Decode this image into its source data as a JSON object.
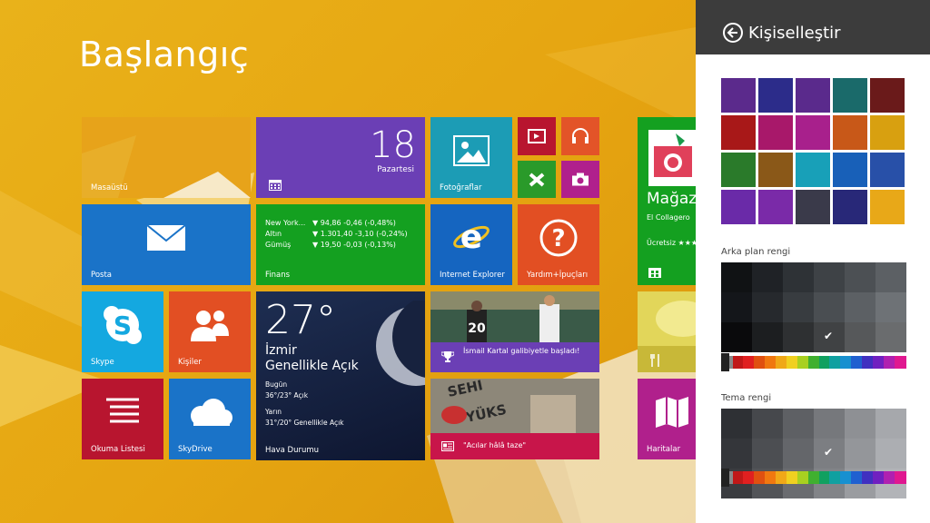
{
  "start": {
    "title": "Başlangıç",
    "tiles": {
      "desktop": "Masaüstü",
      "calendar_number": "18",
      "calendar_day": "Pazartesi",
      "photos": "Fotoğraflar",
      "mail": "Posta",
      "finance": "Finans",
      "finance_rows": [
        {
          "name": "New York...",
          "value": "▼ 94,86 -0,46 (-0,48%)"
        },
        {
          "name": "Altın",
          "value": "▼ 1.301,40 -3,10 (-0,24%)"
        },
        {
          "name": "Gümüş",
          "value": "▼ 19,50 -0,03 (-0,13%)"
        }
      ],
      "ie": "Internet Explorer",
      "help": "Yardım+İpuçları",
      "skype": "Skype",
      "people": "Kişiler",
      "weather_temp": "27°",
      "weather_city": "İzmir",
      "weather_condition": "Genellikle Açık",
      "weather_today_label": "Bugün",
      "weather_today_value": "36°/23° Açık",
      "weather_tomorrow_label": "Yarın",
      "weather_tomorrow_value": "31°/20° Genellikle Açık",
      "weather": "Hava Durumu",
      "sports_news": "İsmail Kartal galibiyetle başladı!",
      "reading": "Okuma Listesi",
      "skydrive": "SkyDrive",
      "news_headline": "\"Acılar hâlâ taze\"",
      "store_title": "Mağaza",
      "store_app": "El Collagero",
      "store_price": "Ücretsiz ★★★★★",
      "maps": "Haritalar"
    }
  },
  "panel": {
    "title": "Kişiselleştir",
    "background_color_label": "Arka plan rengi",
    "theme_color_label": "Tema rengi",
    "pattern_colors": [
      "#5b2a8c",
      "#2c2c8a",
      "#5a2a8c",
      "#1a6a6a",
      "#6a1a1a",
      "#a81818",
      "#a8186a",
      "#a8208c",
      "#c85818",
      "#d8a010",
      "#2a7a2a",
      "#8a5818",
      "#18a0b8",
      "#1860b8",
      "#2850a8",
      "#6a2aa8",
      "#7a2aa8",
      "#3a3a4a",
      "#282878",
      "#e8a818"
    ],
    "background_shades": [
      [
        "#101214",
        "#1f2226",
        "#2e3236",
        "#3e4246",
        "#4c5054",
        "#5c6064"
      ],
      [
        "#14161a",
        "#26292d",
        "#383c40",
        "#4a4e52",
        "#5c6064",
        "#6e7276"
      ],
      [
        "#0a0a0c",
        "#1c1e20",
        "#2e3032",
        "#404244",
        "#56585a",
        "#6a6c6e"
      ]
    ],
    "theme_shades": [
      [
        "#2e3034",
        "#46484c",
        "#5e6064",
        "#76787c",
        "#8e9094",
        "#a6a8ac"
      ],
      [
        "#34363a",
        "#4c4e52",
        "#64666a",
        "#7c7e82",
        "#94969a",
        "#acaeb2"
      ],
      [
        "#3a3c40",
        "#525458",
        "#6a6c70",
        "#828488",
        "#9a9ca0",
        "#b2b4b8"
      ]
    ],
    "rainbow": [
      "#c01818",
      "#e02020",
      "#e05010",
      "#f07810",
      "#f0a818",
      "#f0d020",
      "#a8d020",
      "#40b030",
      "#10a060",
      "#10a0a0",
      "#1890d0",
      "#2060d0",
      "#4030c0",
      "#7020c0",
      "#b020b0",
      "#e01890"
    ]
  }
}
